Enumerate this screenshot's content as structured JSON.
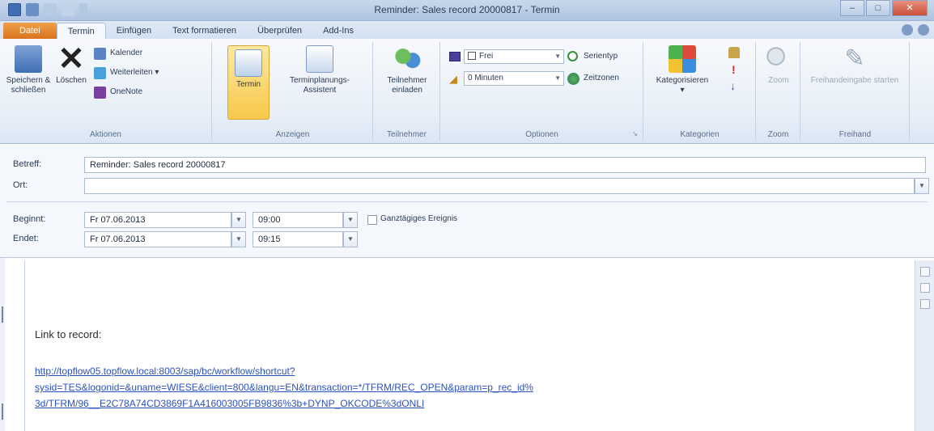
{
  "window": {
    "title": "Reminder: Sales record 20000817 - Termin"
  },
  "tabs": [
    "Datei",
    "Termin",
    "Einfügen",
    "Text formatieren",
    "Überprüfen",
    "Add-Ins"
  ],
  "ribbon": {
    "aktionen": {
      "label": "Aktionen",
      "save_close": "Speichern & schließen",
      "delete": "Löschen",
      "calendar": "Kalender",
      "forward": "Weiterleiten",
      "onenote": "OneNote"
    },
    "anzeigen": {
      "label": "Anzeigen",
      "termin": "Termin",
      "assistant": "Terminplanungs-Assistent"
    },
    "teilnehmer": {
      "label": "Teilnehmer",
      "invite": "Teilnehmer einladen"
    },
    "optionen": {
      "label": "Optionen",
      "show_as": "Frei",
      "reminder": "0 Minuten",
      "series": "Serientyp",
      "timezones": "Zeitzonen"
    },
    "kategorien": {
      "label": "Kategorien",
      "categorize": "Kategorisieren"
    },
    "zoom": {
      "label": "Zoom",
      "zoom": "Zoom"
    },
    "freihand": {
      "label": "Freihand",
      "start_ink": "Freihandeingabe starten"
    }
  },
  "form": {
    "subject_label": "Betreff:",
    "subject_value": "Reminder: Sales record 20000817",
    "location_label": "Ort:",
    "location_value": "",
    "start_label": "Beginnt:",
    "start_date": "Fr 07.06.2013",
    "start_time": "09:00",
    "allday_label": "Ganztägiges Ereignis",
    "end_label": "Endet:",
    "end_date": "Fr 07.06.2013",
    "end_time": "09:15"
  },
  "body": {
    "heading": "Link to record:",
    "link_line1": "http://topflow05.topflow.local:8003/sap/bc/workflow/shortcut?",
    "link_line2": "sysid=TES&logonid=&uname=WIESE&client=800&langu=EN&transaction=*/TFRM/REC_OPEN&param=p_rec_id%",
    "link_line3": "3d/TFRM/96__E2C78A74CD3869F1A416003005FB9836%3b+DYNP_OKCODE%3dONLI"
  },
  "colors": {
    "file_tab": "#d9731d",
    "link": "#2a52be",
    "ribbon_bg": "#e8eff8"
  }
}
